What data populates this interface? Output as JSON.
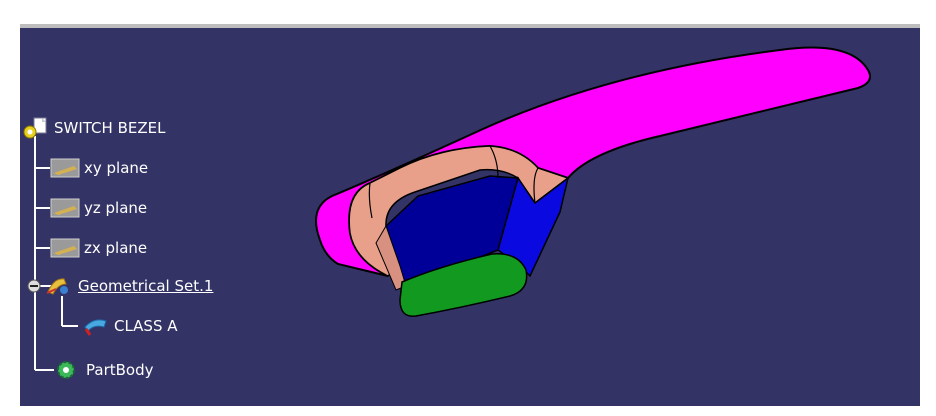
{
  "tree": {
    "root": {
      "label": "SWITCH BEZEL",
      "icon": "part-document-icon"
    },
    "planes": [
      {
        "label": "xy plane",
        "icon": "plane-icon"
      },
      {
        "label": "yz plane",
        "icon": "plane-icon"
      },
      {
        "label": "zx plane",
        "icon": "plane-icon"
      }
    ],
    "geometrical_set": {
      "label": "Geometrical Set.1",
      "icon": "geometrical-set-icon",
      "collapse_icon": "minus-node-icon"
    },
    "surface": {
      "label": "CLASS A",
      "icon": "surface-icon"
    },
    "body": {
      "label": "PartBody",
      "icon": "gear-body-icon"
    }
  },
  "colors": {
    "background": "#333366",
    "surface_magenta": "#ff00ff",
    "fillet_salmon": "#e8a08a",
    "wall_blue": "#0000cc",
    "floor_green": "#129a20",
    "tree_text": "#ffffff"
  }
}
